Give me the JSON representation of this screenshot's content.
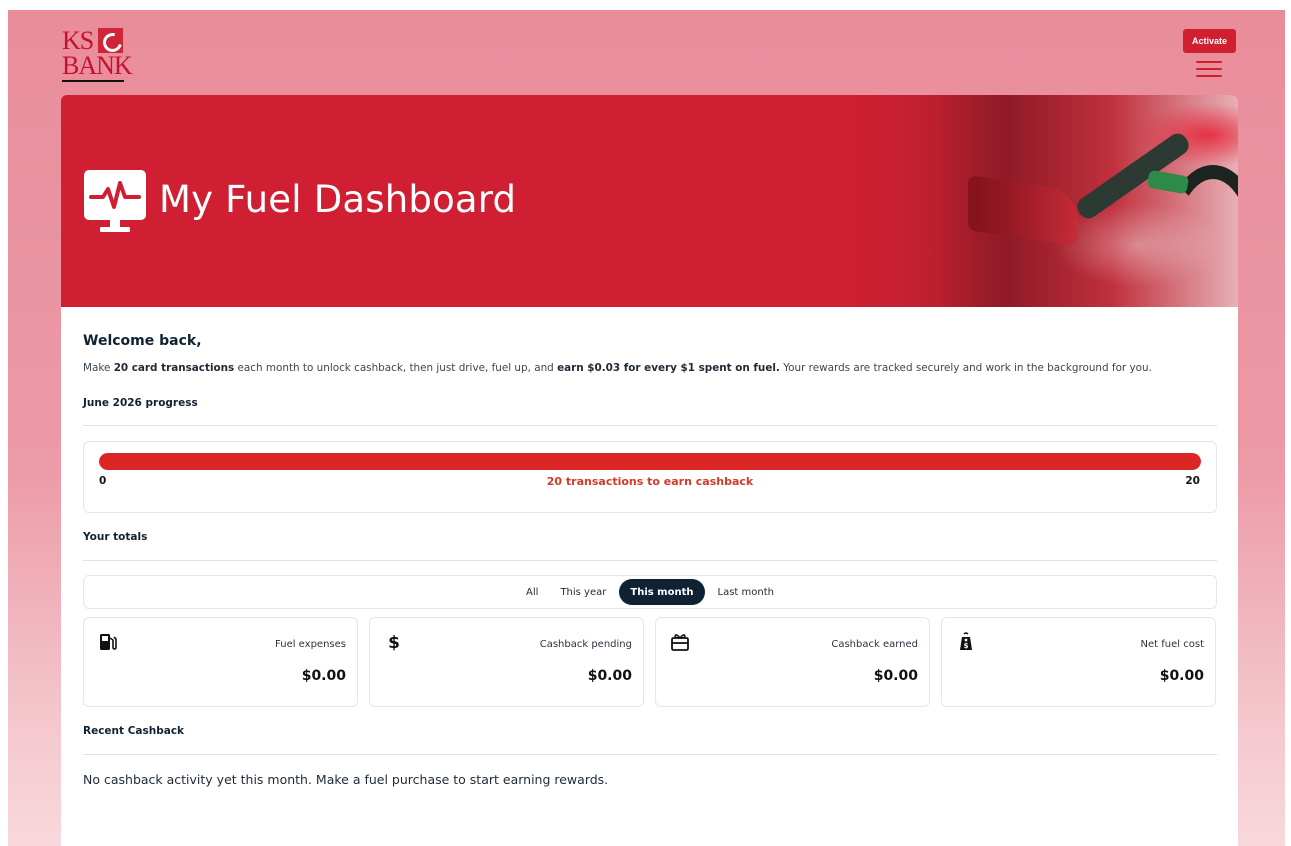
{
  "header": {
    "logo_line1": "KS",
    "logo_line2": "BANK",
    "activate_label": "Activate"
  },
  "hero": {
    "title": "My Fuel Dashboard",
    "icon": "monitor-pulse-icon"
  },
  "welcome": {
    "heading": "Welcome back,",
    "intro_part1": "Make ",
    "intro_bold1": "20 card transactions",
    "intro_part2": " each month to unlock cashback, then just drive, fuel up, and ",
    "intro_bold2": "earn $0.03 for every $1 spent on fuel.",
    "intro_part3": " Your rewards are tracked securely and work in the background for you."
  },
  "progress": {
    "title": "June 2026 progress",
    "min": "0",
    "max": "20",
    "label": "20 transactions to earn cashback",
    "fraction": 1.0
  },
  "totals": {
    "title": "Your totals",
    "filters": [
      {
        "label": "All",
        "active": false
      },
      {
        "label": "This year",
        "active": false
      },
      {
        "label": "This month",
        "active": true
      },
      {
        "label": "Last month",
        "active": false
      }
    ],
    "cards": [
      {
        "icon": "fuel-pump-icon",
        "label": "Fuel expenses",
        "value": "$0.00"
      },
      {
        "icon": "dollar-sign-icon",
        "label": "Cashback pending",
        "value": "$0.00"
      },
      {
        "icon": "gift-card-icon",
        "label": "Cashback earned",
        "value": "$0.00"
      },
      {
        "icon": "price-tag-icon",
        "label": "Net fuel cost",
        "value": "$0.00"
      }
    ]
  },
  "recent": {
    "title": "Recent Cashback",
    "empty_message": "No cashback activity yet this month. Make a fuel purchase to start earning rewards."
  },
  "colors": {
    "brand_red": "#d01f33",
    "progress_red": "#dc2626",
    "navy": "#0f2233"
  }
}
